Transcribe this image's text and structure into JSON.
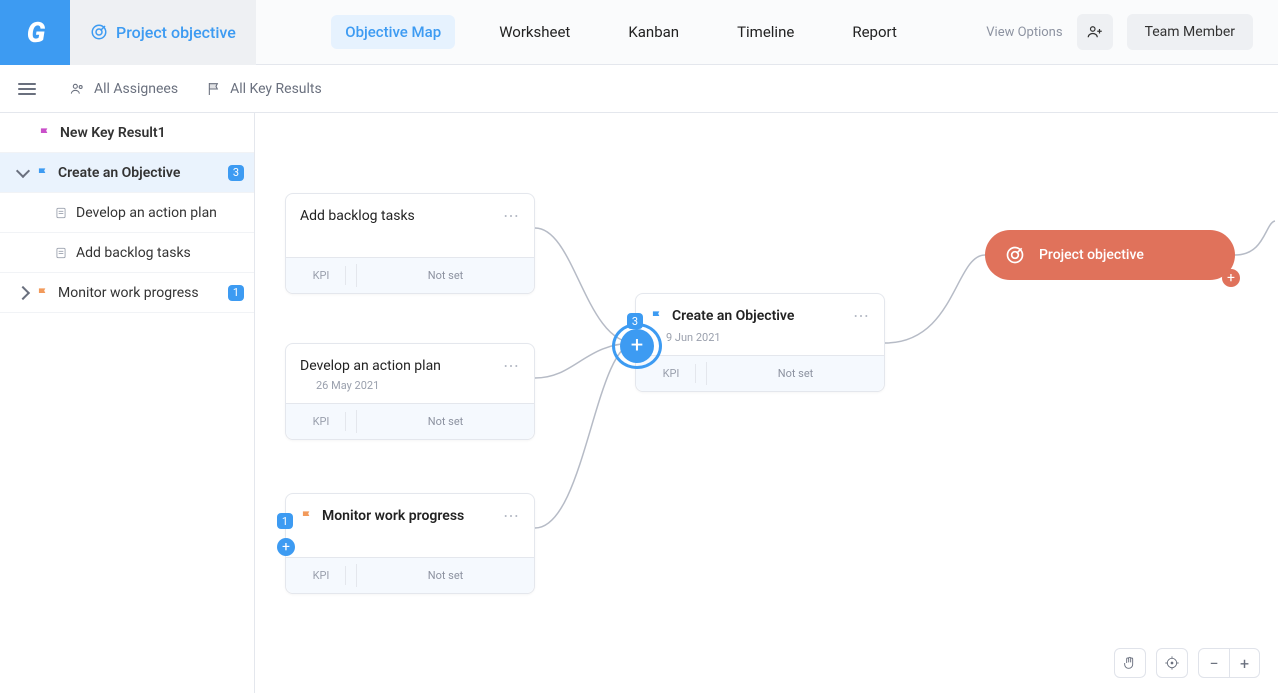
{
  "header": {
    "page_title": "Project objective",
    "tabs": [
      "Objective Map",
      "Worksheet",
      "Kanban",
      "Timeline",
      "Report"
    ],
    "active_tab": 0,
    "view_options": "View Options",
    "team_member": "Team Member"
  },
  "filters": {
    "assignees": "All Assignees",
    "key_results": "All Key Results"
  },
  "sidebar": [
    {
      "label": "New Key Result1",
      "icon": "flag",
      "color": "#c94fc9",
      "type": "leaf"
    },
    {
      "label": "Create an Objective",
      "icon": "flag",
      "color": "#3d9bf2",
      "type": "expandable",
      "expanded": true,
      "badge": "3",
      "children": [
        {
          "label": "Develop an action plan",
          "icon": "doc"
        },
        {
          "label": "Add backlog tasks",
          "icon": "doc"
        }
      ]
    },
    {
      "label": "Monitor work progress",
      "icon": "flag",
      "color": "#f29a5b",
      "type": "expandable",
      "expanded": false,
      "badge": "1"
    }
  ],
  "canvas": {
    "kpi_label": "KPI",
    "not_set": "Not set",
    "cards": {
      "c1": {
        "title": "Add backlog tasks",
        "date": ""
      },
      "c2": {
        "title": "Develop an action plan",
        "date": "26 May 2021"
      },
      "c3": {
        "title": "Monitor work progress",
        "date": "",
        "flag_color": "#f29a5b",
        "child_badge": "1"
      },
      "mid": {
        "title": "Create an Objective",
        "date": "9 Jun 2021",
        "flag_color": "#3d9bf2",
        "child_badge": "3"
      },
      "objective": {
        "title": "Project objective"
      }
    }
  }
}
